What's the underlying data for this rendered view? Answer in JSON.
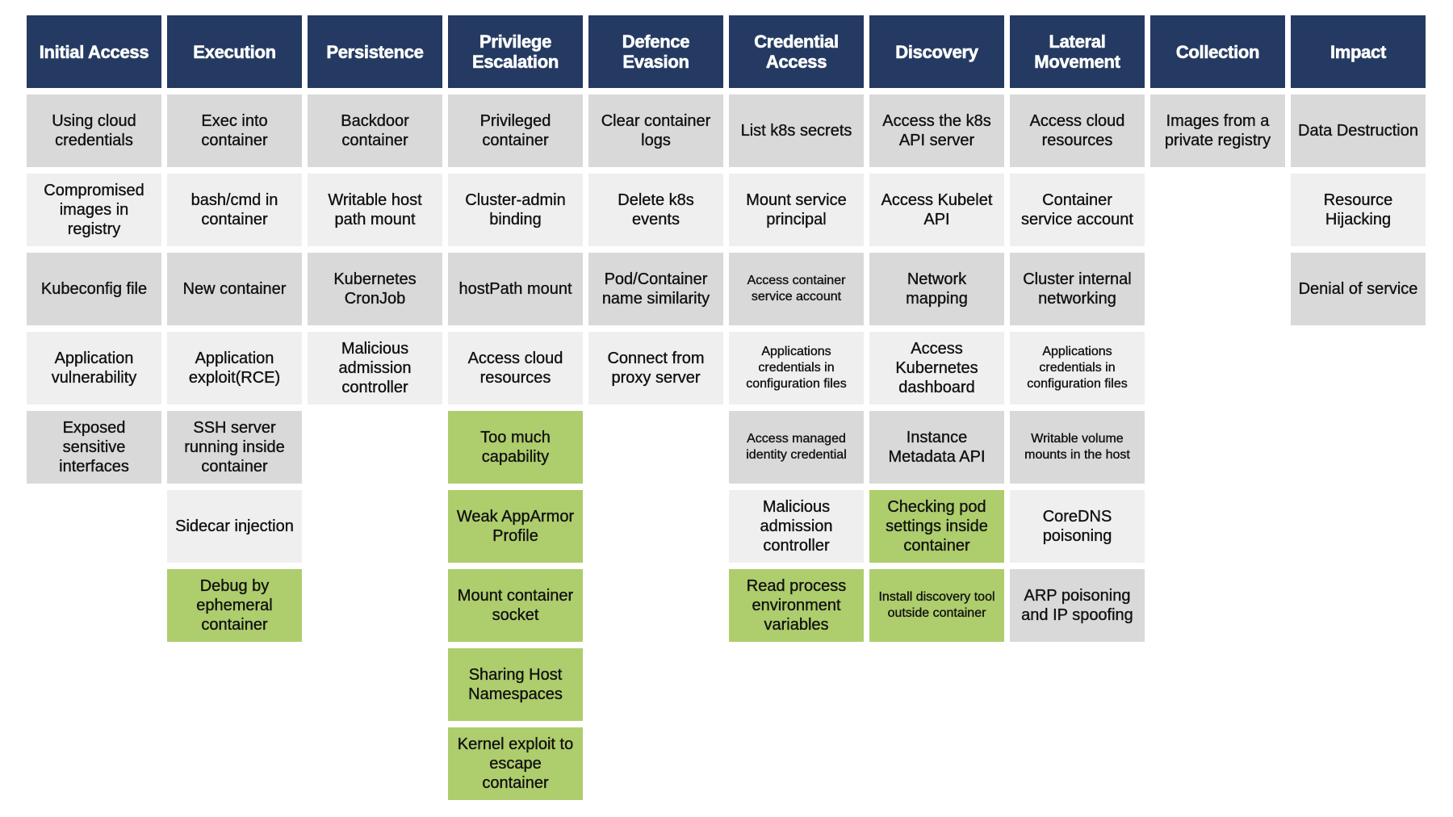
{
  "colors": {
    "header": "#243a62",
    "dark": "#d9d9d9",
    "light": "#efefef",
    "green": "#aecd6c"
  },
  "columns": [
    {
      "title": "Initial Access",
      "cells": [
        {
          "label": "Using cloud credentials",
          "style": "dark"
        },
        {
          "label": "Compromised images in registry",
          "style": "light"
        },
        {
          "label": "Kubeconfig file",
          "style": "dark"
        },
        {
          "label": "Application vulnerability",
          "style": "light"
        },
        {
          "label": "Exposed sensitive interfaces",
          "style": "dark"
        }
      ]
    },
    {
      "title": "Execution",
      "cells": [
        {
          "label": "Exec into container",
          "style": "dark"
        },
        {
          "label": "bash/cmd in container",
          "style": "light"
        },
        {
          "label": "New container",
          "style": "dark"
        },
        {
          "label": "Application exploit(RCE)",
          "style": "light"
        },
        {
          "label": "SSH server running inside container",
          "style": "dark"
        },
        {
          "label": "Sidecar injection",
          "style": "light"
        },
        {
          "label": "Debug by ephemeral container",
          "style": "green"
        }
      ]
    },
    {
      "title": "Persistence",
      "cells": [
        {
          "label": "Backdoor container",
          "style": "dark"
        },
        {
          "label": "Writable host path mount",
          "style": "light"
        },
        {
          "label": "Kubernetes CronJob",
          "style": "dark"
        },
        {
          "label": "Malicious admission controller",
          "style": "light"
        }
      ]
    },
    {
      "title": "Privilege Escalation",
      "cells": [
        {
          "label": "Privileged container",
          "style": "dark"
        },
        {
          "label": "Cluster-admin binding",
          "style": "light"
        },
        {
          "label": "hostPath mount",
          "style": "dark"
        },
        {
          "label": "Access cloud resources",
          "style": "light"
        },
        {
          "label": "Too much capability",
          "style": "green"
        },
        {
          "label": "Weak AppArmor Profile",
          "style": "green"
        },
        {
          "label": "Mount container socket",
          "style": "green"
        },
        {
          "label": "Sharing Host Namespaces",
          "style": "green"
        },
        {
          "label": "Kernel exploit to escape container",
          "style": "green"
        }
      ]
    },
    {
      "title": "Defence Evasion",
      "cells": [
        {
          "label": "Clear container logs",
          "style": "dark"
        },
        {
          "label": "Delete k8s events",
          "style": "light"
        },
        {
          "label": "Pod/Container name similarity",
          "style": "dark"
        },
        {
          "label": "Connect from proxy server",
          "style": "light"
        }
      ]
    },
    {
      "title": "Credential Access",
      "cells": [
        {
          "label": "List k8s secrets",
          "style": "dark"
        },
        {
          "label": "Mount service principal",
          "style": "light"
        },
        {
          "label": "Access container service account",
          "style": "dark",
          "small": true
        },
        {
          "label": "Applications credentials in configuration files",
          "style": "light",
          "small": true
        },
        {
          "label": "Access managed identity credential",
          "style": "dark",
          "small": true
        },
        {
          "label": "Malicious admission controller",
          "style": "light"
        },
        {
          "label": "Read process environment variables",
          "style": "green"
        }
      ]
    },
    {
      "title": "Discovery",
      "cells": [
        {
          "label": "Access the k8s API server",
          "style": "dark"
        },
        {
          "label": "Access Kubelet API",
          "style": "light"
        },
        {
          "label": "Network mapping",
          "style": "dark"
        },
        {
          "label": "Access Kubernetes dashboard",
          "style": "light"
        },
        {
          "label": "Instance Metadata API",
          "style": "dark"
        },
        {
          "label": "Checking pod settings inside container",
          "style": "green"
        },
        {
          "label": "Install discovery tool outside container",
          "style": "green",
          "small": true
        }
      ]
    },
    {
      "title": "Lateral Movement",
      "cells": [
        {
          "label": "Access cloud resources",
          "style": "dark"
        },
        {
          "label": "Container service account",
          "style": "light"
        },
        {
          "label": "Cluster internal networking",
          "style": "dark"
        },
        {
          "label": "Applications credentials in configuration files",
          "style": "light",
          "small": true
        },
        {
          "label": "Writable volume mounts in the host",
          "style": "dark",
          "small": true
        },
        {
          "label": "CoreDNS poisoning",
          "style": "light"
        },
        {
          "label": "ARP poisoning and IP spoofing",
          "style": "dark"
        }
      ]
    },
    {
      "title": "Collection",
      "cells": [
        {
          "label": "Images from a private registry",
          "style": "dark"
        }
      ]
    },
    {
      "title": "Impact",
      "cells": [
        {
          "label": "Data Destruction",
          "style": "dark"
        },
        {
          "label": "Resource Hijacking",
          "style": "light"
        },
        {
          "label": "Denial of service",
          "style": "dark"
        }
      ]
    }
  ]
}
